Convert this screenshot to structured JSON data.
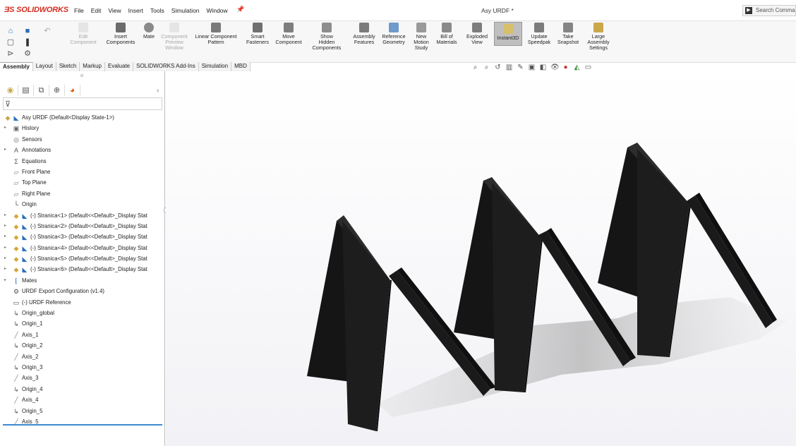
{
  "app": {
    "logo_brand": "SOLIDWORKS",
    "document_title": "Asy URDF *"
  },
  "menu": [
    "File",
    "Edit",
    "View",
    "Insert",
    "Tools",
    "Simulation",
    "Window"
  ],
  "search": {
    "placeholder": "Search Comman"
  },
  "ribbon": {
    "buttons": [
      {
        "label": "Edit\nComponent",
        "enabled": false
      },
      {
        "label": "Insert\nComponents",
        "enabled": true
      },
      {
        "label": "Mate",
        "enabled": true
      },
      {
        "label": "Component\nPreview\nWindow",
        "enabled": false
      },
      {
        "label": "Linear Component\nPattern",
        "enabled": true
      },
      {
        "label": "Smart\nFasteners",
        "enabled": true
      },
      {
        "label": "Move\nComponent",
        "enabled": true
      },
      {
        "label": "Show\nHidden\nComponents",
        "enabled": true
      },
      {
        "label": "Assembly\nFeatures",
        "enabled": true
      },
      {
        "label": "Reference\nGeometry",
        "enabled": true
      },
      {
        "label": "New\nMotion\nStudy",
        "enabled": true
      },
      {
        "label": "Bill of\nMaterials",
        "enabled": true
      },
      {
        "label": "Exploded\nView",
        "enabled": true
      },
      {
        "label": "Instant3D",
        "enabled": true,
        "active": true
      },
      {
        "label": "Update\nSpeedpak",
        "enabled": true
      },
      {
        "label": "Take\nSnapshot",
        "enabled": true
      },
      {
        "label": "Large\nAssembly\nSettings",
        "enabled": true
      }
    ]
  },
  "tabs": [
    "Assembly",
    "Layout",
    "Sketch",
    "Markup",
    "Evaluate",
    "SOLIDWORKS Add-Ins",
    "Simulation",
    "MBD"
  ],
  "active_tab": "Assembly",
  "tree": {
    "root": "Asy URDF  (Default<Display State-1>)",
    "items": [
      {
        "label": "History",
        "icon": "history-icon",
        "expandable": true
      },
      {
        "label": "Sensors",
        "icon": "sensor-icon",
        "expandable": false
      },
      {
        "label": "Annotations",
        "icon": "annotation-icon",
        "expandable": true
      },
      {
        "label": "Equations",
        "icon": "equation-icon",
        "expandable": false
      },
      {
        "label": "Front Plane",
        "icon": "plane-icon",
        "expandable": false
      },
      {
        "label": "Top Plane",
        "icon": "plane-icon",
        "expandable": false
      },
      {
        "label": "Right Plane",
        "icon": "plane-icon",
        "expandable": false
      },
      {
        "label": "Origin",
        "icon": "origin-icon",
        "expandable": false
      },
      {
        "label": "(-) Stranica<1> (Default<<Default>_Display Stat",
        "icon": "part-icon",
        "expandable": true
      },
      {
        "label": "(-) Stranica<2> (Default<<Default>_Display Stat",
        "icon": "part-icon",
        "expandable": true
      },
      {
        "label": "(-) Stranica<3> (Default<<Default>_Display Stat",
        "icon": "part-icon",
        "expandable": true
      },
      {
        "label": "(-) Stranica<4> (Default<<Default>_Display Stat",
        "icon": "part-icon",
        "expandable": true
      },
      {
        "label": "(-) Stranica<5> (Default<<Default>_Display Stat",
        "icon": "part-icon",
        "expandable": true
      },
      {
        "label": "(-) Stranica<6> (Default<<Default>_Display Stat",
        "icon": "part-icon",
        "expandable": true
      },
      {
        "label": "Mates",
        "icon": "mates-icon",
        "expandable": true
      },
      {
        "label": "URDF Export Configuration (v1.4)",
        "icon": "urdf-icon",
        "expandable": false
      },
      {
        "label": "(-) URDF Reference",
        "icon": "sketch-3d-icon",
        "expandable": false
      },
      {
        "label": "Origin_global",
        "icon": "coordinate-system-icon",
        "expandable": false
      },
      {
        "label": "Origin_1",
        "icon": "coordinate-system-icon",
        "expandable": false
      },
      {
        "label": "Axis_1",
        "icon": "axis-icon",
        "expandable": false
      },
      {
        "label": "Origin_2",
        "icon": "coordinate-system-icon",
        "expandable": false
      },
      {
        "label": "Axis_2",
        "icon": "axis-icon",
        "expandable": false
      },
      {
        "label": "Origin_3",
        "icon": "coordinate-system-icon",
        "expandable": false
      },
      {
        "label": "Axis_3",
        "icon": "axis-icon",
        "expandable": false
      },
      {
        "label": "Origin_4",
        "icon": "coordinate-system-icon",
        "expandable": false
      },
      {
        "label": "Axis_4",
        "icon": "axis-icon",
        "expandable": false
      },
      {
        "label": "Origin_5",
        "icon": "coordinate-system-icon",
        "expandable": false
      },
      {
        "label": "Axis_5",
        "icon": "axis-icon",
        "expandable": false
      }
    ]
  },
  "colors": {
    "brand_red": "#d52b1e",
    "model_face": "#202020",
    "selection_blue": "#3c89d1"
  }
}
